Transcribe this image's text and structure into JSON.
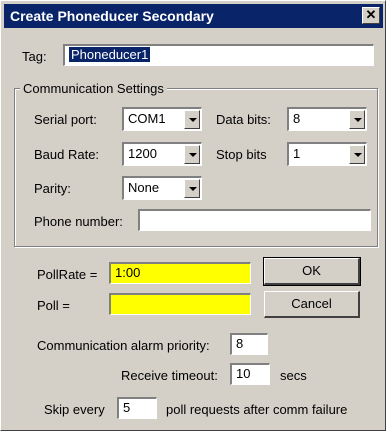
{
  "window": {
    "title": "Create Phoneducer Secondary",
    "close_glyph": "✕"
  },
  "tag": {
    "label": "Tag:",
    "value": "Phoneducer1"
  },
  "comm": {
    "group_title": "Communication Settings",
    "serial_port": {
      "label": "Serial port:",
      "value": "COM1"
    },
    "data_bits": {
      "label": "Data bits:",
      "value": "8"
    },
    "baud_rate": {
      "label": "Baud Rate:",
      "value": "1200"
    },
    "stop_bits": {
      "label": "Stop bits",
      "value": "1"
    },
    "parity": {
      "label": "Parity:",
      "value": "None"
    },
    "phone_number": {
      "label": "Phone number:",
      "value": ""
    }
  },
  "poll_rate": {
    "label": "PollRate =",
    "value": "1:00"
  },
  "poll": {
    "label": "Poll =",
    "value": ""
  },
  "buttons": {
    "ok": "OK",
    "cancel": "Cancel"
  },
  "alarm_priority": {
    "label": "Communication alarm priority:",
    "value": "8"
  },
  "receive_timeout": {
    "label": "Receive timeout:",
    "value": "10",
    "unit": "secs"
  },
  "skip": {
    "prefix": "Skip every",
    "value": "5",
    "suffix": "poll requests after comm failure"
  },
  "colors": {
    "titlebar": "#0a246a",
    "dialog_bg": "#d4d0c8",
    "highlight_field": "#ffff00"
  },
  "icons": {
    "dropdown": "chevron-down-icon",
    "close": "close-icon"
  }
}
